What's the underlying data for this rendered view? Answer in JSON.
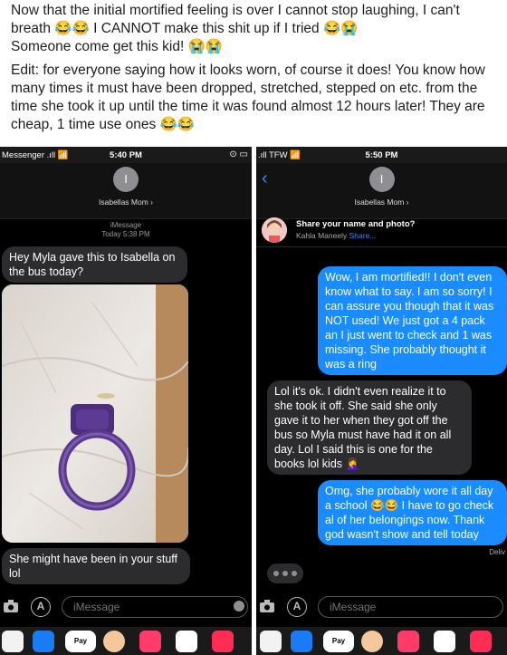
{
  "post": {
    "paragraph1": "Now that the initial mortified feeling is over I cannot stop laughing, I can't breath 😂😂 I CANNOT make this shit up if I tried 😂😭",
    "paragraph1b": "Someone come get this kid! 😭😭",
    "paragraph2": "Edit: for everyone saying how it looks worn, of course it does! You know how many times it must have been dropped, stretched, stepped on etc. from the time she took it up until the time it was found almost 12 hours later! They are cheap, 1 time use ones 😂😂"
  },
  "left_screen": {
    "status": {
      "carrier": "Messenger .ıll 📶",
      "time": "5:40 PM",
      "right": "⊙ ▭"
    },
    "contact": {
      "initial": "I",
      "name": "Isabellas Mom ›"
    },
    "imessage_label": "iMessage",
    "timestamp": "Today 5:38 PM",
    "messages": [
      {
        "text": "Hey Myla gave this to Isabella on the bus today?"
      },
      {
        "text": "She might have been in your stuff lol"
      }
    ],
    "input_placeholder": "iMessage"
  },
  "right_screen": {
    "status": {
      "carrier": ".ıll TFW 📶",
      "time": "5:50 PM"
    },
    "contact": {
      "initial": "I",
      "name": "Isabellas Mom ›"
    },
    "share": {
      "title": "Share your name and photo?",
      "subtitle": "Kahla Maneely",
      "link": "Share..."
    },
    "messages": [
      {
        "text": "Wow, I am mortified!! I don't even know what to say. I am so sorry! I can assure you though that it was NOT used! We just got a 4 pack an I just went to check and 1 was missing. She probably thought it was a ring"
      },
      {
        "text": "Lol it's ok. I didn't even realize it to she took it off. She said she only gave it to her when they got off the bus so Myla must have had it on all day. Lol I said this is one for the books lol kids 🤦‍♀️"
      },
      {
        "text": "Omg, she probably wore it all day a school 😂😂 I have to go check al of her belongings now. Thank god wasn't show and tell today"
      }
    ],
    "delivered": "Deliv",
    "input_placeholder": "iMessage"
  },
  "tray": {
    "pay_label": "Pay"
  },
  "colors": {
    "bubble_out": "#1b8cff",
    "bubble_in": "#2c2c2e",
    "link": "#2f8cff",
    "ring": "#5a3a8c"
  }
}
